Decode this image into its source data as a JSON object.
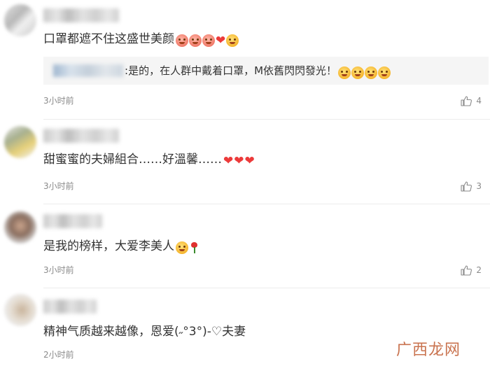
{
  "comments": [
    {
      "text": "口罩都遮不住这盛世美颜",
      "time": "3小时前",
      "likes": "4",
      "reply": {
        "text": "是的，在人群中戴着口罩，M依舊閃閃發光！",
        "prefix": ":"
      }
    },
    {
      "text": "甜蜜蜜的夫婦組合……好溫馨……",
      "time": "3小时前",
      "likes": "3"
    },
    {
      "text": "是我的榜样，大爱李美人",
      "time": "3小时前",
      "likes": "2"
    },
    {
      "text": "精神气质越来越像，恩爱(˶°3°)-♡夫妻",
      "time": "2小时前",
      "likes": ""
    }
  ],
  "watermark": "广西龙网",
  "colors": {
    "heart": "#ec3a3a",
    "time": "#8a8a8a",
    "reply_bg": "#f5f5f5",
    "watermark": "#c9734f"
  },
  "icons": {
    "like": "thumbs-up-icon"
  }
}
